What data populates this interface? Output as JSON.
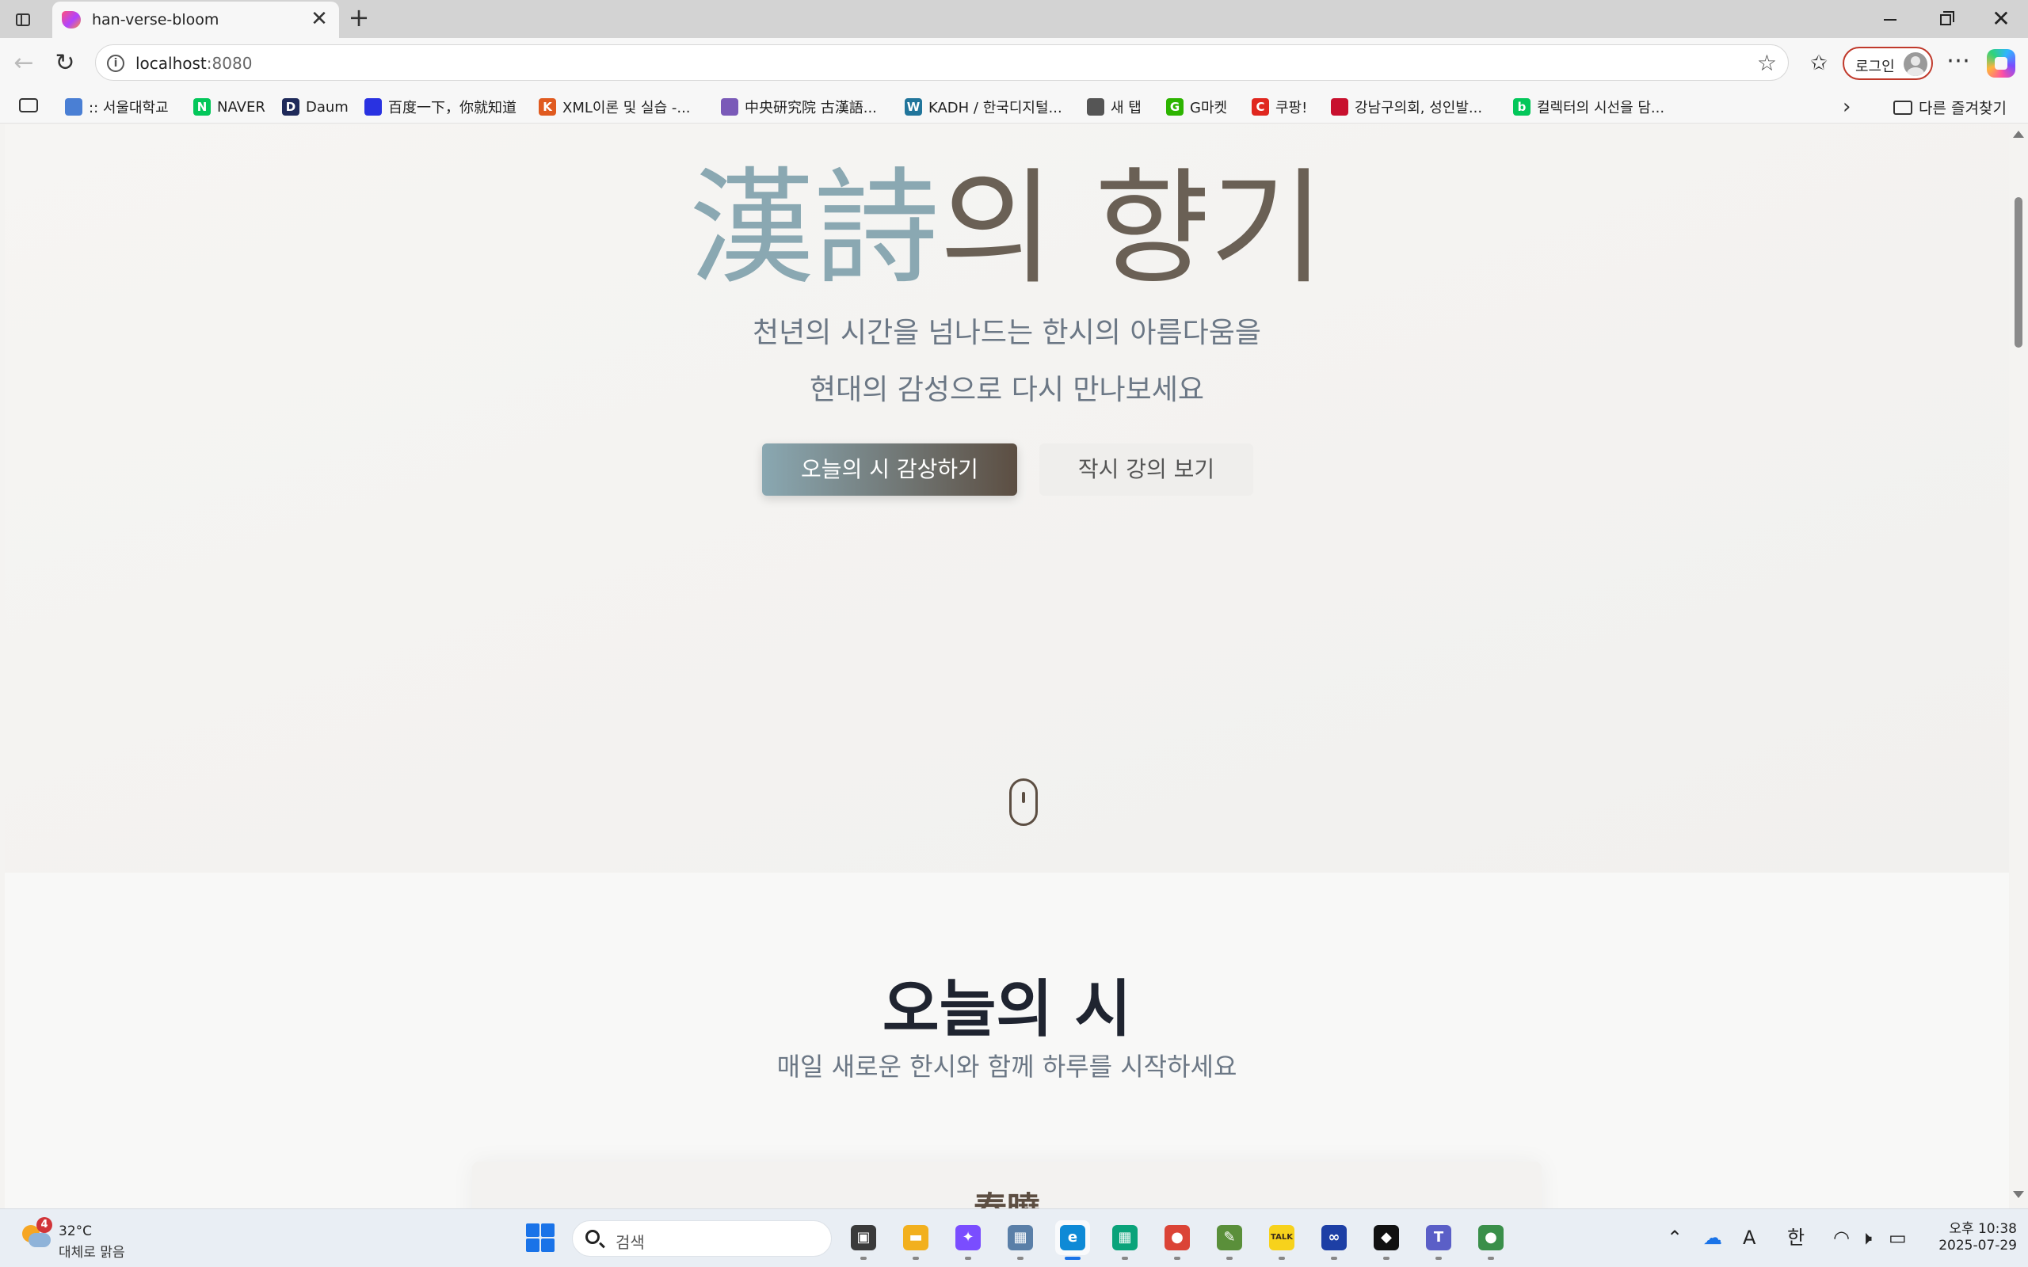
{
  "browser": {
    "tab_title": "han-verse-bloom",
    "tab_close": "✕",
    "new_tab": "+",
    "url_host": "localhost",
    "url_port": ":8080",
    "login_label": "로그인",
    "more": "⋯"
  },
  "bookmarks": [
    {
      "label": ":: 서울대학교",
      "icon": "snu-icon",
      "color": "#4a7fd4"
    },
    {
      "label": "NAVER",
      "icon": "naver-icon",
      "color": "#03c75a",
      "glyph": "N"
    },
    {
      "label": "Daum",
      "icon": "daum-icon",
      "color": "#1f2a5a",
      "glyph": "D"
    },
    {
      "label": "百度一下，你就知道",
      "icon": "baidu-icon",
      "color": "#2932e1"
    },
    {
      "label": "XML이론 및 실습 -...",
      "icon": "k-icon",
      "color": "#e05a1f",
      "glyph": "K"
    },
    {
      "label": "中央研究院 古漢語...",
      "icon": "sinica-icon",
      "color": "#7a5ab8"
    },
    {
      "label": "KADH / 한국디지털...",
      "icon": "wordpress-icon",
      "color": "#21759b",
      "glyph": "W"
    },
    {
      "label": "새 탭",
      "icon": "newtab-icon",
      "color": "#555"
    },
    {
      "label": "G마켓",
      "icon": "gmarket-icon",
      "color": "#2db400",
      "glyph": "G"
    },
    {
      "label": "쿠팡!",
      "icon": "coupang-icon",
      "color": "#e0271f",
      "glyph": "C"
    },
    {
      "label": "강남구의회, 성인발...",
      "icon": "gangnam-icon",
      "color": "#c8102e"
    },
    {
      "label": "컬렉터의 시선을 담...",
      "icon": "blog-icon",
      "color": "#03c75a",
      "glyph": "b"
    }
  ],
  "bookmarks_folder": "다른 즐겨찾기",
  "hero": {
    "title_hanja": "漢詩",
    "title_hangul": "의 향기",
    "subtitle_line1": "천년의 시간을 넘나드는 한시의 아름다움을",
    "subtitle_line2": "현대의 감성으로 다시 만나보세요",
    "primary_button": "오늘의 시 감상하기",
    "secondary_button": "작시 강의 보기"
  },
  "today_section": {
    "title": "오늘의 시",
    "subtitle": "매일 새로운 한시와 함께 하루를 시작하세요",
    "poem_title": "春曉"
  },
  "taskbar": {
    "weather_badge": "4",
    "weather_temp": "32°C",
    "weather_condition": "대체로 맑음",
    "search_placeholder": "검색",
    "tray_ime_a": "A",
    "tray_ime_han": "한",
    "clock_time": "오후 10:38",
    "clock_date": "2025-07-29"
  },
  "taskbar_apps": [
    {
      "name": "task-view-icon",
      "color": "#3a3a3a",
      "glyph": "▣"
    },
    {
      "name": "file-explorer-icon",
      "color": "#f2b01e",
      "glyph": "▬"
    },
    {
      "name": "copilot-app-icon",
      "color": "#7a4dff",
      "glyph": "✦"
    },
    {
      "name": "photo-viewer-icon",
      "color": "#5a7fa8",
      "glyph": "▦"
    },
    {
      "name": "edge-icon",
      "color": "#0f8ad6",
      "glyph": "e"
    },
    {
      "name": "calculator-grid-icon",
      "color": "#0aa37a",
      "glyph": "▦"
    },
    {
      "name": "chrome-icon",
      "color": "#db4437",
      "glyph": "●"
    },
    {
      "name": "notepad-icon",
      "color": "#5a8f3a",
      "glyph": "✎"
    },
    {
      "name": "kakaotalk-icon",
      "color": "#f7d21c",
      "glyph": "TALK"
    },
    {
      "name": "webex-icon",
      "color": "#1d3fa5",
      "glyph": "∞"
    },
    {
      "name": "capcut-icon",
      "color": "#111111",
      "glyph": "◆"
    },
    {
      "name": "teams-icon",
      "color": "#5b5fc7",
      "glyph": "T"
    },
    {
      "name": "chrome-profile-icon",
      "color": "#3a8f4a",
      "glyph": "●"
    }
  ]
}
